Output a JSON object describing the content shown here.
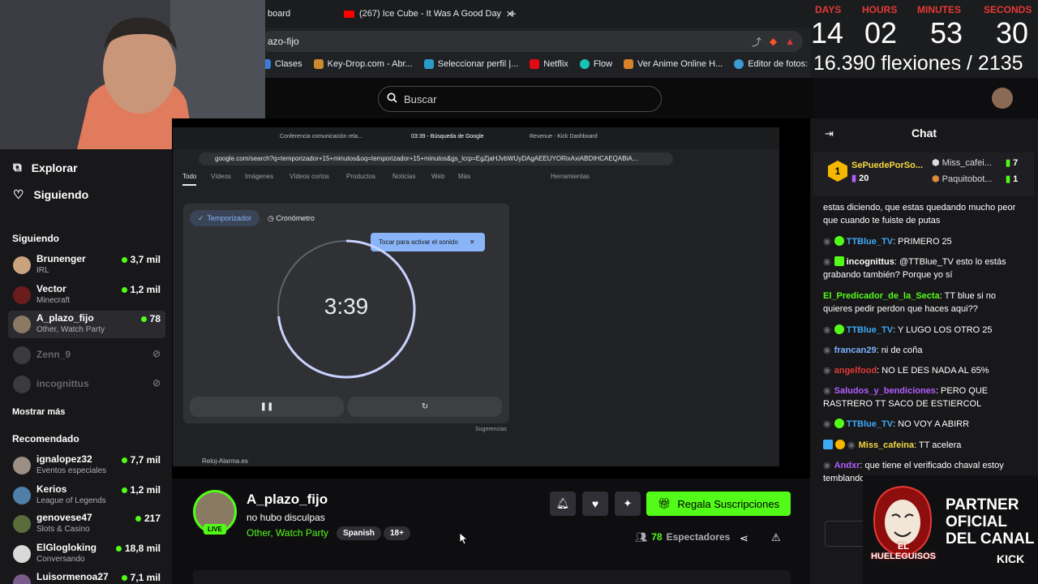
{
  "browser": {
    "tabs": [
      {
        "label": "board"
      },
      {
        "label": "(267) Ice Cube - It Was A Good Day"
      }
    ],
    "address": "azo-fijo",
    "bookmarks": [
      "Clases",
      "Key-Drop.com - Abr...",
      "Seleccionar perfil |...",
      "Netflix",
      "Flow",
      "Ver Anime Online H...",
      "Editor de fotos: Pixlr..."
    ]
  },
  "kick": {
    "search_placeholder": "Buscar"
  },
  "countdown": {
    "labels": [
      "DAYS",
      "HOURS",
      "MINUTES",
      "SECONDS"
    ],
    "values": [
      "14",
      "02",
      "53",
      "30"
    ],
    "pushups": "16.390 flexiones / 2135"
  },
  "sidebar": {
    "nav": [
      "Explorar",
      "Siguiendo"
    ],
    "following_title": "Siguiendo",
    "following": [
      {
        "name": "Brunenger",
        "sub": "IRL",
        "viewers": "3,7 mil",
        "color": "#c9a27e"
      },
      {
        "name": "Vector",
        "sub": "Minecraft",
        "viewers": "1,2 mil",
        "color": "#6b1d1d"
      },
      {
        "name": "A_plazo_fijo",
        "sub": "Other, Watch Party",
        "viewers": "78",
        "color": "#8a7a63"
      }
    ],
    "offline": [
      "Zenn_9",
      "incognittus"
    ],
    "show_more": "Mostrar más",
    "recommended_title": "Recomendado",
    "recommended": [
      {
        "name": "ignalopez32",
        "sub": "Eventos especiales",
        "viewers": "7,7 mil",
        "color": "#9c8f86"
      },
      {
        "name": "Kerios",
        "sub": "League of Legends",
        "viewers": "1,2 mil",
        "color": "#4f7fa8"
      },
      {
        "name": "genovese47",
        "sub": "Slots & Casino",
        "viewers": "217",
        "color": "#5a6b3c"
      },
      {
        "name": "ElGlogloking",
        "sub": "Conversando",
        "viewers": "18,8 mil",
        "color": "#d9d9d9"
      },
      {
        "name": "Luisormenoa27",
        "sub": "",
        "viewers": "7,1 mil",
        "color": "#7a5c8a"
      }
    ]
  },
  "google": {
    "tabs": [
      "Conferencia comunicación rela...",
      "03:39 - Búsqueda de Google",
      "Revenue - Kick Dashboard"
    ],
    "url": "google.com/search?q=temporizador+15+minutos&oq=temporizador+15+minutos&gs_lcrp=EgZjaHJvbWUyDAgAEEUYORixAxiABDIHCAEQABiA...",
    "nav": [
      "Todo",
      "Vídeos",
      "Imágenes",
      "Vídeos cortos",
      "Productos",
      "Noticias",
      "Web",
      "Más",
      "Herramientas"
    ],
    "timer_tab": "Temporizador",
    "stopwatch_tab": "Cronómetro",
    "tooltip": "Tocar para activar el sonido",
    "time": "3:39",
    "suggestions": "Sugerencias",
    "result": "Reloj-Alarma.es"
  },
  "stream": {
    "name": "A_plazo_fijo",
    "title": "no hubo disculpas",
    "category": "Other, Watch Party",
    "tags": [
      "Spanish",
      "18+"
    ],
    "live": "LIVE",
    "gift_button": "Regala Suscripciones",
    "viewers_count": "78",
    "viewers_label": "Espectadores"
  },
  "chat": {
    "title": "Chat",
    "top_gifter": {
      "name": "SePuedePorSo...",
      "count": "20"
    },
    "gifters": [
      {
        "name": "Miss_cafei...",
        "count": "7"
      },
      {
        "name": "Paquitobot...",
        "count": "1"
      }
    ],
    "messages": [
      {
        "user": "",
        "text": "estas diciendo, que estas quedando mucho peor que cuando te fuiste de putas",
        "color": "#ffffff"
      },
      {
        "user": "TTBlue_TV",
        "text": ": PRIMERO 25",
        "color": "#3fa9f5"
      },
      {
        "user": "incognittus",
        "text": ": @TTBlue_TV esto lo estás grabando también? Porque yo sí",
        "color": "#ffffff"
      },
      {
        "user": "El_Predicador_de_la_Secta",
        "text": ": TT blue si no quieres pedir perdon que haces aqui??",
        "color": "#53fc18"
      },
      {
        "user": "TTBlue_TV",
        "text": ": Y LUGO LOS OTRO 25",
        "color": "#3fa9f5"
      },
      {
        "user": "francan29",
        "text": ": ni de coña",
        "color": "#7ab4ff"
      },
      {
        "user": "angelfood",
        "text": ": NO LE DES NADA AL 65%",
        "color": "#e53935"
      },
      {
        "user": "Saludos_y_bendiciones",
        "text": ": PERO QUE RASTRERO TT SACO DE ESTIERCOL",
        "color": "#b45cff"
      },
      {
        "user": "TTBlue_TV",
        "text": ": NO VOY A ABIRR",
        "color": "#3fa9f5"
      },
      {
        "user": "Miss_cafeina",
        "text": ": TT acelera",
        "color": "#f5d742"
      },
      {
        "user": "Andxr",
        "text": ": que tiene el verificado chaval estoy temblando",
        "color": "#b45cff"
      }
    ]
  },
  "partner": {
    "text_lines": [
      "PARTNER",
      "OFICIAL",
      "DEL CANAL"
    ],
    "brand": "KICK",
    "logo_text": "EL HUELEGUISOS"
  }
}
